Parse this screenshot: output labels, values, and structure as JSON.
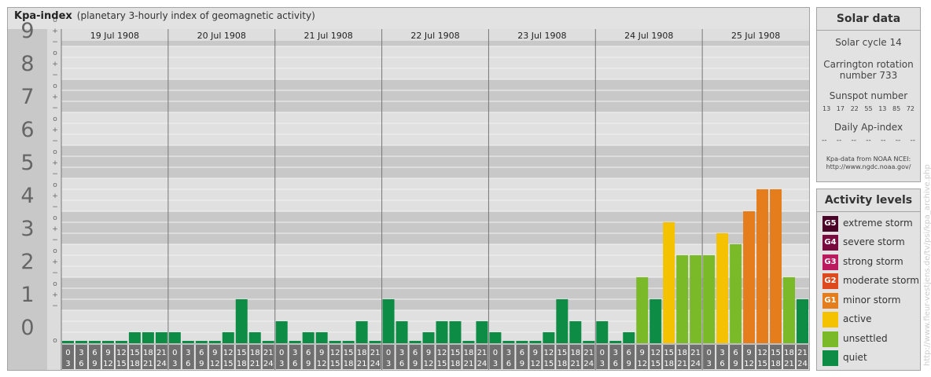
{
  "header": {
    "title": "Kpa-index",
    "subtitle": "(planetary 3-hourly index of geomagnetic activity)"
  },
  "chart_data": {
    "type": "bar",
    "title": "Kpa-index",
    "subtitle": "(planetary 3-hourly index of geomagnetic activity)",
    "ylim": [
      0,
      9
    ],
    "y_ticks": [
      "0",
      "1",
      "2",
      "3",
      "4",
      "5",
      "6",
      "7",
      "8",
      "9"
    ],
    "minor_ticks": [
      "o",
      "+",
      "−"
    ],
    "days": [
      "19 Jul 1908",
      "20 Jul 1908",
      "21 Jul 1908",
      "22 Jul 1908",
      "23 Jul 1908",
      "24 Jul 1908",
      "25 Jul 1908"
    ],
    "hour_labels_top": [
      "0",
      "3",
      "6",
      "9",
      "12",
      "15",
      "18",
      "21"
    ],
    "hour_labels_bottom": [
      "3",
      "6",
      "9",
      "12",
      "15",
      "18",
      "21",
      "24"
    ],
    "kp": [
      [
        0.0,
        0.0,
        0.0,
        0.0,
        0.0,
        0.333,
        0.333,
        0.333
      ],
      [
        0.333,
        0.0,
        0.0,
        0.0,
        0.333,
        1.333,
        0.333,
        0.0
      ],
      [
        0.667,
        0.0,
        0.333,
        0.333,
        0.0,
        0.0,
        0.667,
        0.0
      ],
      [
        1.333,
        0.667,
        0.0,
        0.333,
        0.667,
        0.667,
        0.0,
        0.667
      ],
      [
        0.333,
        0.0,
        0.0,
        0.0,
        0.333,
        1.333,
        0.667,
        0.0
      ],
      [
        0.667,
        0.0,
        0.333,
        2.0,
        1.333,
        3.667,
        2.667,
        2.667
      ],
      [
        2.667,
        3.333,
        3.0,
        4.0,
        4.667,
        4.667,
        2.0,
        1.333
      ]
    ],
    "level_colors": {
      "quiet": "#0c8c44",
      "unsettled": "#7aba28",
      "active": "#f4c200",
      "minor": "#e57d1c",
      "moderate": "#dc4a1e",
      "strong": "#bb1a5e",
      "severe": "#7a0b3e",
      "extreme": "#4a0427"
    }
  },
  "solar": {
    "heading": "Solar data",
    "cycle": "Solar cycle 14",
    "rotation_line1": "Carrington rotation",
    "rotation_line2": "number 733",
    "sunspot_title": "Sunspot number",
    "sunspots": [
      "13",
      "17",
      "22",
      "55",
      "13",
      "85",
      "72"
    ],
    "ap_title": "Daily Ap-index",
    "ap": [
      "--",
      "--",
      "--",
      "--",
      "--",
      "--",
      "--"
    ],
    "source_line1": "Kpa-data from NOAA NCEI:",
    "source_line2": "http://www.ngdc.noaa.gov/"
  },
  "levels": {
    "heading": "Activity levels",
    "items": [
      {
        "badge": "G5",
        "label": "extreme storm",
        "color": "#4a0427"
      },
      {
        "badge": "G4",
        "label": "severe storm",
        "color": "#7a0b3e"
      },
      {
        "badge": "G3",
        "label": "strong storm",
        "color": "#bb1a5e"
      },
      {
        "badge": "G2",
        "label": "moderate storm",
        "color": "#dc4a1e"
      },
      {
        "badge": "G1",
        "label": "minor storm",
        "color": "#e57d1c"
      },
      {
        "badge": "",
        "label": "active",
        "color": "#f4c200"
      },
      {
        "badge": "",
        "label": "unsettled",
        "color": "#7aba28"
      },
      {
        "badge": "",
        "label": "quiet",
        "color": "#0c8c44"
      }
    ]
  },
  "credit": "http://www.fleur-vestjens.de/tv/psi/kpa_archive.php"
}
